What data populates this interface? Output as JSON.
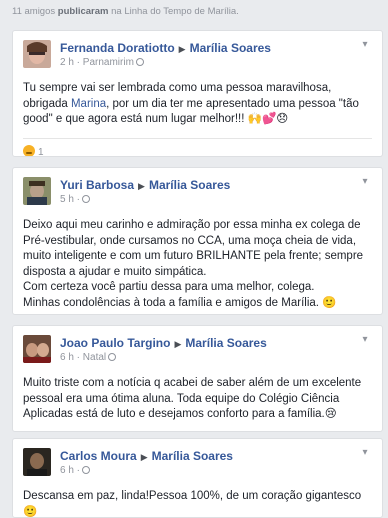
{
  "header": {
    "text_count": "11 amigos",
    "text_action": "publicaram",
    "text_rest": "na Linha do Tempo de Marília."
  },
  "posts": [
    {
      "author": "Fernanda Doratiotto",
      "target": "Marília Soares",
      "time": "2 h",
      "place": "Parnamirim",
      "text_before": "Tu sempre vai ser lembrada como uma pessoa maravilhosa, obrigada ",
      "text_link": "Marina",
      "text_after": ", por um dia ter me apresentado uma pessoa \"tão good\" e que agora está num lugar melhor!!! 🙌💕😞",
      "reaction_count": "1"
    },
    {
      "author": "Yuri Barbosa",
      "target": "Marília Soares",
      "time": "5 h",
      "text": "Deixo aqui meu carinho e admiração por essa minha ex colega de Pré-vestibular, onde cursamos no CCA, uma moça cheia de vida, muito inteligente e com um futuro BRILHANTE pela frente; sempre disposta a ajudar e muito simpática.\nCom certeza você partiu dessa para uma melhor, colega.\nMinhas condolências à toda a família e amigos de Marília. 🙂"
    },
    {
      "author": "Joao Paulo Targino",
      "target": "Marília Soares",
      "time": "6 h",
      "place": "Natal",
      "text": "Muito triste com a notícia q acabei de saber além de um excelente pessoal era uma ótima aluna. Toda equipe do Colégio Ciência Aplicadas está de luto e desejamos conforto para a família.😢"
    },
    {
      "author": "Carlos Moura",
      "target": "Marília Soares",
      "time": "6 h",
      "text": "Descansa em paz, linda!Pessoa 100%, de um coração gigantesco 🙂"
    }
  ]
}
